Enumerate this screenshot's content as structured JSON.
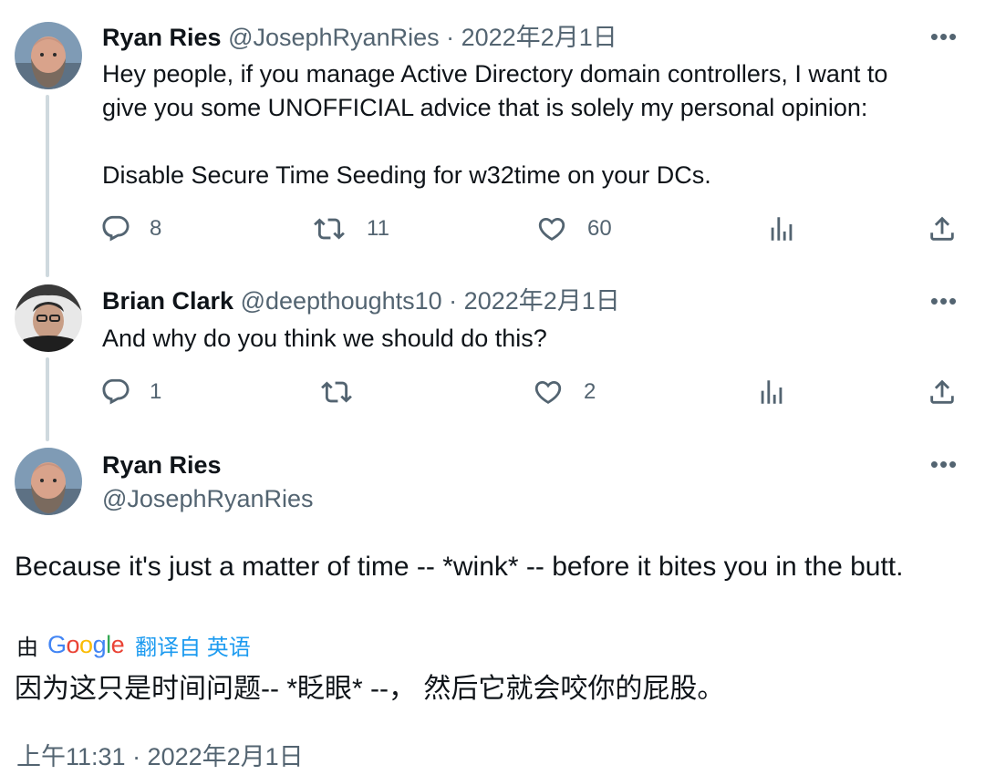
{
  "tweets": [
    {
      "name": "Ryan Ries",
      "handle": "@JosephRyanRies",
      "sep": " · ",
      "date": "2022年2月1日",
      "text": "Hey people, if you manage Active Directory domain controllers, I want to\ngive you some UNOFFICIAL advice that is solely my personal opinion:\n\nDisable Secure Time Seeding for w32time on your DCs.",
      "replies": "8",
      "retweets": "11",
      "likes": "60"
    },
    {
      "name": "Brian Clark",
      "handle": "@deepthoughts10",
      "sep": " · ",
      "date": "2022年2月1日",
      "text": "And why do you think we should do this?",
      "replies": "1",
      "retweets": "",
      "likes": "2"
    }
  ],
  "main_tweet": {
    "name": "Ryan Ries",
    "handle": "@JosephRyanRies",
    "text": "Because it's just a matter of time -- *wink* -- before it bites you in the butt.",
    "translate_by": "由",
    "google_letters": [
      "G",
      "o",
      "o",
      "g",
      "l",
      "e"
    ],
    "translate_link": "翻译自 英语",
    "translated_text": "因为这只是时间问题-- *眨眼* --， 然后它就会咬你的屁股。",
    "timestamp": "上午11:31 · 2022年2月1日"
  },
  "icons": {
    "more": "more-icon",
    "reply": "reply-icon",
    "retweet": "retweet-icon",
    "like": "like-icon",
    "views": "analytics-icon",
    "share": "share-icon"
  },
  "colors": {
    "text": "#0f1419",
    "muted": "#536471",
    "link": "#1d9bf0",
    "thread_line": "#cfd9de"
  }
}
